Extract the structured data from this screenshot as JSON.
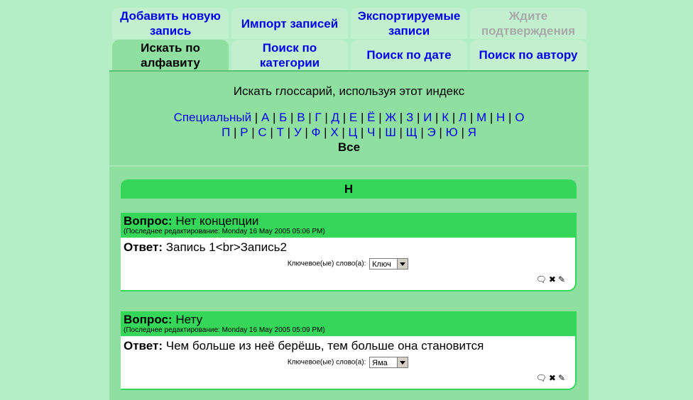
{
  "tabs_row1": [
    {
      "label": "Добавить новую запись",
      "state": "link"
    },
    {
      "label": "Импорт записей",
      "state": "link"
    },
    {
      "label": "Экспортируемые записи",
      "state": "link"
    },
    {
      "label": "Ждите подтверждения",
      "state": "disabled"
    }
  ],
  "tabs_row2": [
    {
      "label": "Искать по алфавиту",
      "state": "active"
    },
    {
      "label": "Поиск по категории",
      "state": "link"
    },
    {
      "label": "Поиск по дате",
      "state": "link"
    },
    {
      "label": "Поиск по автору",
      "state": "link"
    }
  ],
  "index": {
    "caption": "Искать глоссарий, используя этот индекс",
    "special": "Специальный",
    "row1": [
      "А",
      "Б",
      "В",
      "Г",
      "Д",
      "Е",
      "Ё",
      "Ж",
      "З",
      "И",
      "К",
      "Л",
      "М",
      "Н",
      "О"
    ],
    "row2": [
      "П",
      "Р",
      "С",
      "Т",
      "У",
      "Ф",
      "Х",
      "Ц",
      "Ч",
      "Ш",
      "Щ",
      "Э",
      "Ю",
      "Я"
    ],
    "all": "Все"
  },
  "section_letter": "Н",
  "entries": [
    {
      "question_label": "Вопрос:",
      "question": "Нет концепции",
      "meta": "(Последнее редактирование: Monday 16 May 2005 05:06 PM)",
      "answer_label": "Ответ:",
      "answer": "Запись 1<br>Запись2",
      "keyword_label": "Ключевое(ые) слово(а):",
      "keyword": "Ключ"
    },
    {
      "question_label": "Вопрос:",
      "question": "Нету",
      "meta": "(Последнее редактирование: Monday 16 May 2005 05:09 PM)",
      "answer_label": "Ответ:",
      "answer": "Чем больше из неё берёшь, тем больше она становится",
      "keyword_label": "Ключевое(ые) слово(а):",
      "keyword": "Яма"
    }
  ],
  "icons": [
    "comment-icon",
    "delete-icon",
    "edit-icon"
  ]
}
